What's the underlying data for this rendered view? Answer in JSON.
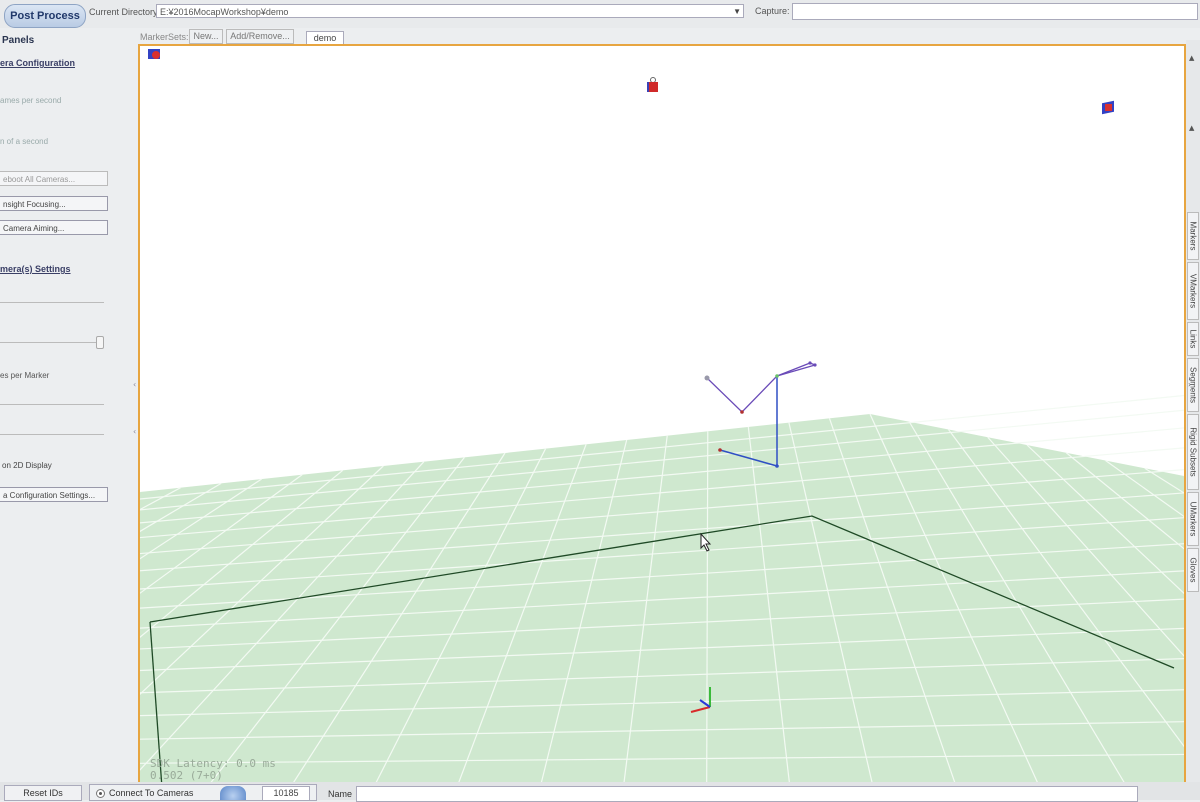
{
  "toolbar": {
    "post_process_label": "Post Process",
    "current_directory_label": "Current Directory:",
    "current_directory_value": "E:¥2016MocapWorkshop¥demo",
    "capture_label": "Capture:"
  },
  "markersets": {
    "label": "MarkerSets:",
    "new_label": "New...",
    "add_remove_label": "Add/Remove...",
    "active_tab": "demo"
  },
  "left_panel": {
    "title": "Panels",
    "camera_configuration_title": "era Configuration",
    "frames_per_second_label": "ames per second",
    "fraction_of_second_label": "n of a second",
    "reboot_button": "eboot All Cameras...",
    "insight_button": "nsight Focusing...",
    "aiming_button": "Camera Aiming...",
    "camera_settings_title": "mera(s) Settings",
    "per_marker_label": "es per Marker",
    "on_2d_display_label": "on 2D Display",
    "config_settings_button": "a Configuration Settings..."
  },
  "right_tabs": [
    "Markers",
    "VMarkers",
    "Links",
    "Segments",
    "Rigid Subsets",
    "UMarkers",
    "Gloves"
  ],
  "viewport": {
    "sdk_latency": "SDK Latency: 0.0 ms",
    "frame_info": "0.502 (7+0)"
  },
  "bottom_bar": {
    "reset_ids_label": "Reset IDs",
    "connect_label": "Connect To Cameras",
    "port_value": "10185",
    "name_label": "Name"
  },
  "colors": {
    "viewport_border": "#e7a540",
    "floor": "#cfe8cf",
    "grid_line": "#ffffff",
    "skeleton_purple": "#6a4bb8",
    "skeleton_blue": "#2f4fc4"
  }
}
